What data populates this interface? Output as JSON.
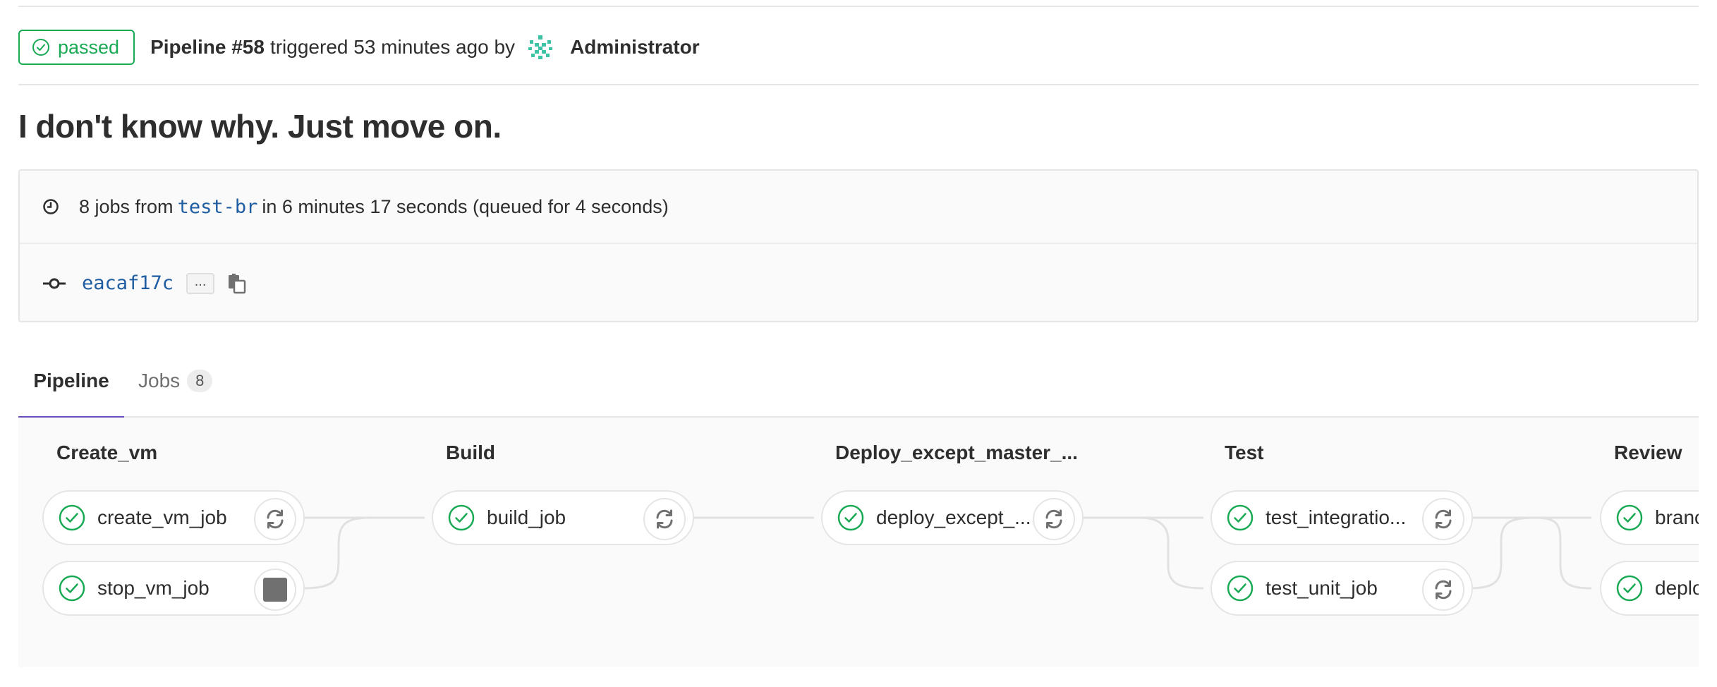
{
  "header": {
    "status": "passed",
    "pipeline_id": "Pipeline #58",
    "triggered_text": "triggered 53 minutes ago by",
    "user": "Administrator"
  },
  "commit": {
    "title": "I don't know why. Just move on.",
    "jobs_prefix": "8 jobs from",
    "branch": "test-br",
    "duration_text": "in 6 minutes 17 seconds (queued for 4 seconds)",
    "sha": "eacaf17c",
    "ellipsis": "..."
  },
  "tabs": {
    "pipeline": "Pipeline",
    "jobs": "Jobs",
    "jobs_count": "8"
  },
  "stages": [
    {
      "name": "Create_vm",
      "jobs": [
        {
          "name": "create_vm_job",
          "status": "success",
          "action": "retry"
        },
        {
          "name": "stop_vm_job",
          "status": "success",
          "action": "manual"
        }
      ]
    },
    {
      "name": "Build",
      "jobs": [
        {
          "name": "build_job",
          "status": "success",
          "action": "retry"
        }
      ]
    },
    {
      "name": "Deploy_except_master_...",
      "jobs": [
        {
          "name": "deploy_except_...",
          "status": "success",
          "action": "retry"
        }
      ]
    },
    {
      "name": "Test",
      "jobs": [
        {
          "name": "test_integratio...",
          "status": "success",
          "action": "retry"
        },
        {
          "name": "test_unit_job",
          "status": "success",
          "action": "retry"
        }
      ]
    },
    {
      "name": "Review",
      "jobs": [
        {
          "name": "branc",
          "status": "success",
          "action": "retry"
        },
        {
          "name": "deploy",
          "status": "success",
          "action": "retry"
        }
      ]
    }
  ],
  "colors": {
    "success": "#1aaa55",
    "link": "#1f5da3",
    "active_tab": "#6b4fbb"
  },
  "icons": {
    "status": "check-circle-icon",
    "avatar": "identicon-avatar-icon",
    "duration": "clock-icon",
    "commit": "commit-icon",
    "copy": "clipboard-icon",
    "retry": "retry-icon",
    "stop": "stop-icon"
  }
}
